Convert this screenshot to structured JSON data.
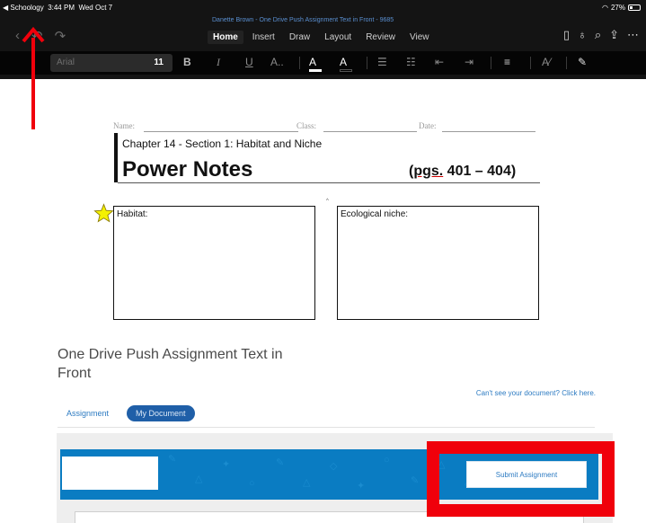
{
  "status_bar": {
    "back_label": "◀ Schoology",
    "time": "3:44 PM",
    "date": "Wed Oct 7",
    "battery": "27%"
  },
  "word": {
    "document_title": "Danette Brown - One Drive Push Assignment Text in Front - 9685",
    "tabs": [
      "Home",
      "Insert",
      "Draw",
      "Layout",
      "Review",
      "View"
    ],
    "active_tab": "Home",
    "font_name": "Arial",
    "font_size": "11",
    "ribbon": {
      "bold": "B",
      "italic": "I",
      "underline": "U",
      "text_effects": "A..",
      "highlight": "A",
      "font_color": "A"
    }
  },
  "document": {
    "name_label": "Name:",
    "class_label": "Class:",
    "date_label": "Date:",
    "chapter": "Chapter 14 - Section 1: Habitat and Niche",
    "heading": "Power Notes",
    "pages_prefix": "(",
    "pages_underlined": "pgs.",
    "pages_suffix": " 401 – 404)",
    "habitat_label": "Habitat:",
    "niche_label": "Ecological niche:",
    "small_mark": "^"
  },
  "assignment": {
    "title": "One Drive Push Assignment Text in Front",
    "cant_see_link": "Can't see your document? Click here.",
    "tabs": [
      "Assignment",
      "My Document"
    ],
    "active_tab": "My Document",
    "submit_label": "Submit Assignment"
  },
  "colors": {
    "accent_blue": "#0a7cc2",
    "annotation_red": "#f0000b",
    "word_dark": "#141414"
  }
}
